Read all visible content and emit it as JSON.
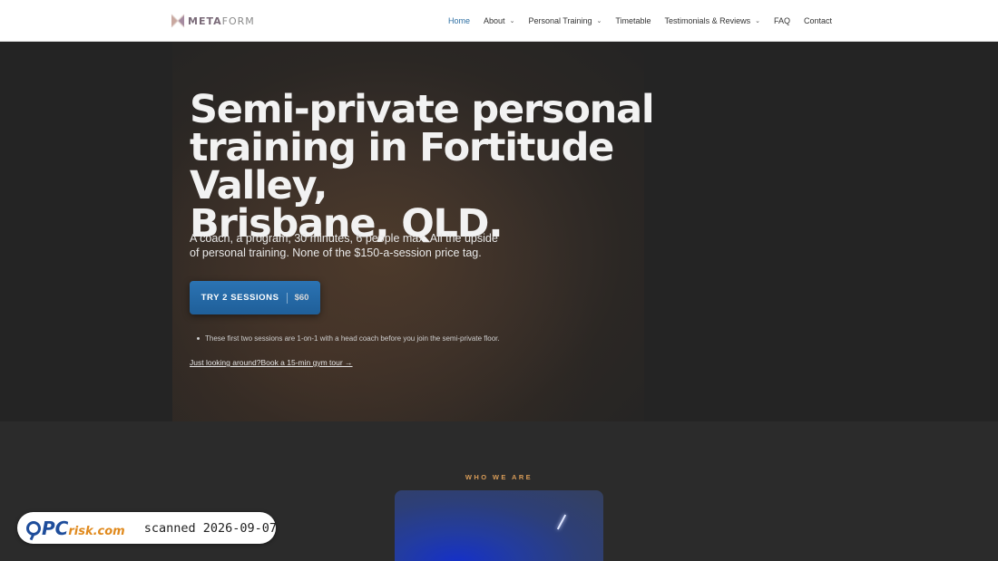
{
  "nav": {
    "logo_text_a": "META",
    "logo_text_b": "FORM",
    "items": [
      {
        "label": "Home",
        "active": true,
        "dropdown": false
      },
      {
        "label": "About",
        "active": false,
        "dropdown": true
      },
      {
        "label": "Personal Training",
        "active": false,
        "dropdown": true
      },
      {
        "label": "Timetable",
        "active": false,
        "dropdown": false
      },
      {
        "label": "Testimonials & Reviews",
        "active": false,
        "dropdown": true
      },
      {
        "label": "FAQ",
        "active": false,
        "dropdown": false
      },
      {
        "label": "Contact",
        "active": false,
        "dropdown": false
      }
    ],
    "chevron_glyph": "⌄"
  },
  "hero": {
    "title_line1": "Semi-private personal",
    "title_line2": "training in Fortitude Valley,",
    "title_line3": "Brisbane, QLD.",
    "subtitle": "A coach, a program, 30 minutes, 6 people max. All the upside of personal training. None of the $150-a-session price tag.",
    "cta_label": "TRY 2 SESSIONS",
    "cta_price": "$60",
    "note": "These first two sessions are 1-on-1 with a head coach before you join the semi-private floor.",
    "tour_link": "Just looking around?Book a 15-min gym tour →"
  },
  "who": {
    "label": "WHO WE ARE"
  },
  "watermark": {
    "brand_a": "PC",
    "brand_b": "risk.com",
    "scan_text": "scanned 2026-09-07"
  },
  "colors": {
    "accent": "#2e6fa3",
    "cta": "#2b73b3",
    "section_label": "#d79b57",
    "hero_bg": "#242424"
  }
}
